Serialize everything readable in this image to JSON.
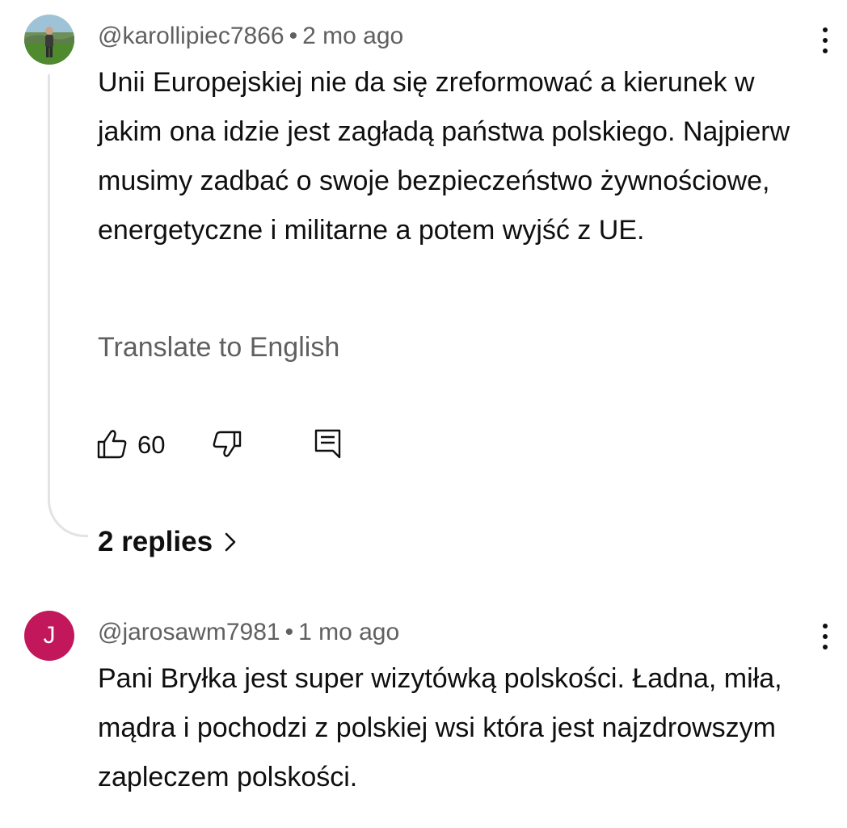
{
  "comments": [
    {
      "author": "@karollipiec7866",
      "separator": "•",
      "time": "2 mo ago",
      "text": "Unii Europejskiej nie da się zreformować a kierunek w jakim ona idzie jest zagładą państwa polskiego. Najpierw musimy zadbać o swoje bezpieczeństwo żywnościowe, energetyczne i militarne a potem wyjść z UE.",
      "translate_label": "Translate to English",
      "like_count": "60",
      "replies_label": "2 replies",
      "avatar_icon": "profile-photo"
    },
    {
      "author": "@jarosawm7981",
      "separator": "•",
      "time": "1 mo ago",
      "text": "Pani Bryłka jest super wizytówką polskości. Ładna, miła, mądra i pochodzi z polskiej wsi która jest najzdrowszym zapleczem polskości.",
      "avatar_letter": "J",
      "avatar_color": "#c2185b"
    }
  ],
  "colors": {
    "text_primary": "#0f0f0f",
    "text_secondary": "#606060",
    "thread_line": "#e3e3e3"
  },
  "icons": {
    "like": "thumbs-up-icon",
    "dislike": "thumbs-down-icon",
    "reply": "comment-reply-icon",
    "more": "more-vertical-icon",
    "chevron": "chevron-right-icon"
  }
}
